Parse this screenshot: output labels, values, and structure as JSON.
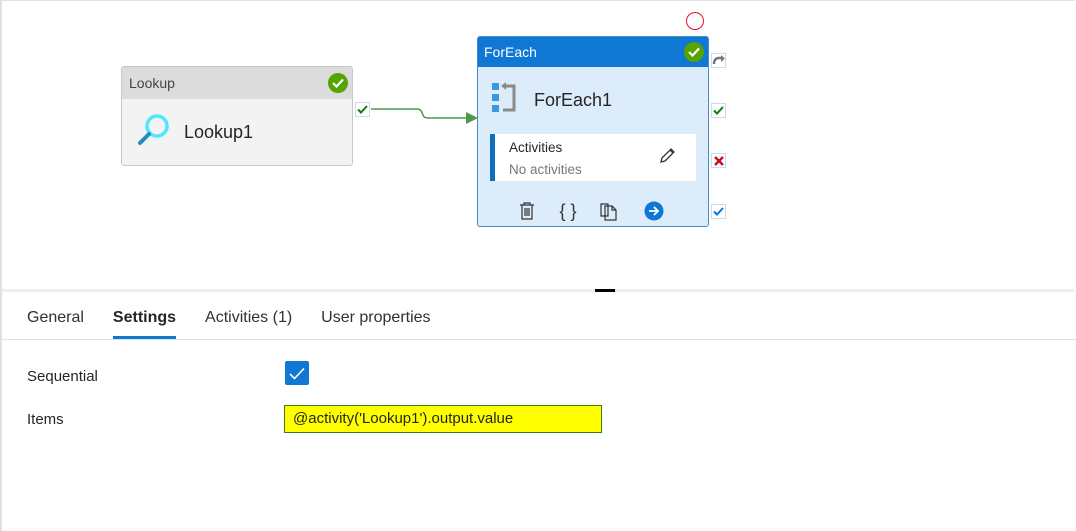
{
  "canvas": {
    "lookup_node": {
      "type_label": "Lookup",
      "name": "Lookup1",
      "status": "succeeded",
      "icon": "search-icon"
    },
    "foreach_node": {
      "type_label": "ForEach",
      "name": "ForEach1",
      "status": "succeeded",
      "icon": "foreach-icon",
      "activities_label": "Activities",
      "activities_value": "No activities",
      "actions": [
        "delete-icon",
        "code-icon",
        "copy-icon",
        "go-to-activities-icon"
      ]
    },
    "ports": [
      "skip",
      "success",
      "failure",
      "completion"
    ],
    "colors": {
      "accent": "#0f78d4",
      "success": "#57a300",
      "connector": "#4e9a4e",
      "failure": "#c50f1f"
    }
  },
  "tabs": [
    {
      "label": "General",
      "active": false
    },
    {
      "label": "Settings",
      "active": true
    },
    {
      "label": "Activities (1)",
      "active": false
    },
    {
      "label": "User properties",
      "active": false
    }
  ],
  "settings": {
    "sequential_label": "Sequential",
    "sequential_checked": true,
    "items_label": "Items",
    "items_value": "@activity('Lookup1').output.value"
  }
}
